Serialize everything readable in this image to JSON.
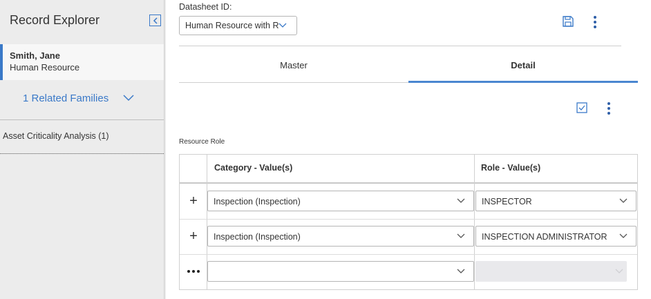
{
  "sidebar": {
    "title": "Record Explorer",
    "record": {
      "name": "Smith, Jane",
      "family": "Human Resource"
    },
    "related_families_label": "1 Related Families",
    "links": [
      {
        "label": "Asset Criticality Analysis (1)"
      }
    ]
  },
  "datasheet": {
    "label": "Datasheet ID:",
    "selected": "Human Resource with R"
  },
  "tabs": [
    {
      "label": "Master"
    },
    {
      "label": "Detail"
    }
  ],
  "active_tab": "Detail",
  "section": {
    "title": "Resource Role"
  },
  "grid": {
    "columns": [
      "Category - Value(s)",
      "Role - Value(s)"
    ],
    "rows": [
      {
        "category": "Inspection (Inspection)",
        "role": "INSPECTOR"
      },
      {
        "category": "Inspection (Inspection)",
        "role": "INSPECTION ADMINISTRATOR"
      },
      {
        "category": "",
        "role": ""
      }
    ]
  },
  "colors": {
    "accent": "#3a79c8",
    "sidebar_bg": "#ececec",
    "tab_underline": "#4a86d0"
  },
  "icons": [
    "collapse-panel-icon",
    "chevron-down-icon",
    "save-icon",
    "kebab-menu-icon",
    "checkbox-icon",
    "plus-icon",
    "ellipsis-icon"
  ]
}
